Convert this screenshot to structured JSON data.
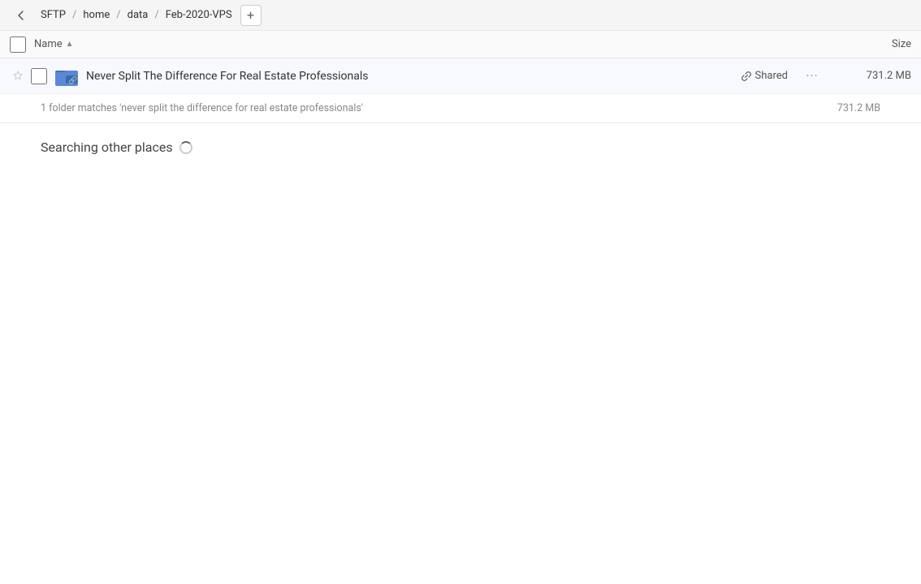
{
  "breadcrumb": {
    "back_icon": "←",
    "items": [
      {
        "label": "SFTP",
        "id": "sftp"
      },
      {
        "label": "home",
        "id": "home"
      },
      {
        "label": "data",
        "id": "data"
      },
      {
        "label": "Feb-2020-VPS",
        "id": "feb-2020-vps"
      }
    ],
    "add_label": "+"
  },
  "columns": {
    "name_label": "Name",
    "sort_icon": "▲",
    "size_label": "Size"
  },
  "file_row": {
    "name": "Never Split The Difference For Real Estate Professionals",
    "shared_label": "Shared",
    "size": "731.2 MB"
  },
  "match_info": {
    "text": "1 folder matches 'never split the difference for real estate professionals'",
    "size": "731.2 MB"
  },
  "searching_section": {
    "title": "Searching other places"
  }
}
